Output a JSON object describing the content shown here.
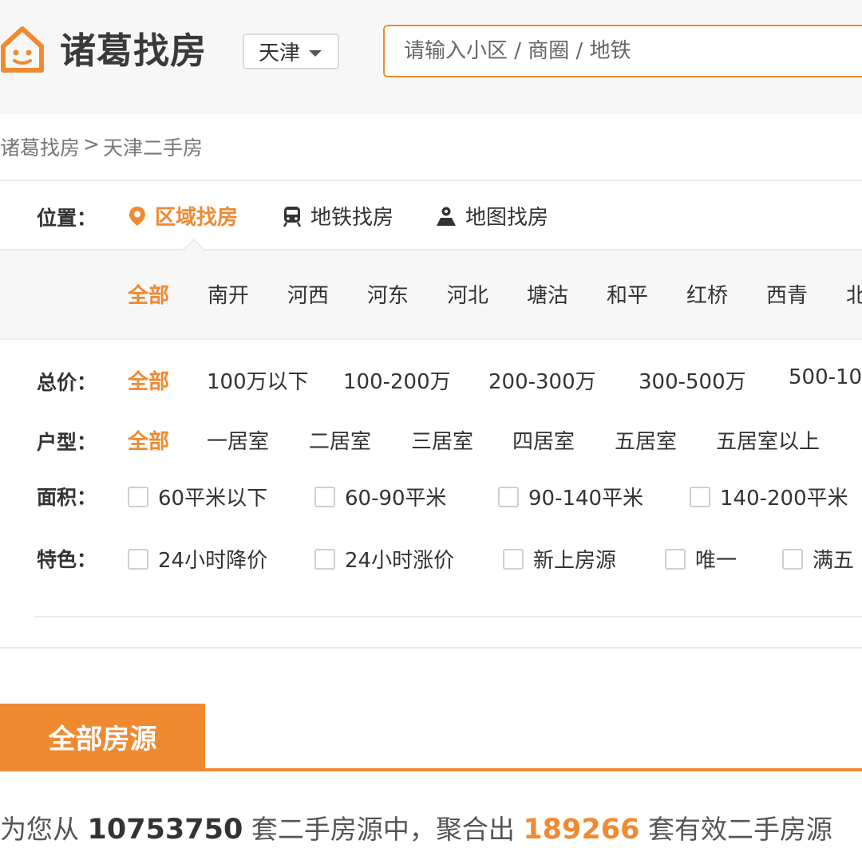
{
  "header": {
    "logo_text": "诸葛找房",
    "city": "天津",
    "search_placeholder": "请输入小区 / 商圈 / 地铁"
  },
  "breadcrumb": {
    "home": "诸葛找房",
    "separator": ">",
    "current": "天津二手房"
  },
  "location": {
    "label": "位置：",
    "tabs": [
      "区域找房",
      "地铁找房",
      "地图找房"
    ],
    "active_tab": "区域找房",
    "districts": [
      "全部",
      "南开",
      "河西",
      "河东",
      "河北",
      "塘沽",
      "和平",
      "红桥",
      "西青",
      "北"
    ]
  },
  "filters": {
    "price": {
      "label": "总价：",
      "options": [
        "全部",
        "100万以下",
        "100-200万",
        "200-300万",
        "300-500万",
        "500-10"
      ]
    },
    "layout": {
      "label": "户型：",
      "options": [
        "全部",
        "一居室",
        "二居室",
        "三居室",
        "四居室",
        "五居室",
        "五居室以上"
      ]
    },
    "area": {
      "label": "面积：",
      "options": [
        "60平米以下",
        "60-90平米",
        "90-140平米",
        "140-200平米"
      ]
    },
    "feature": {
      "label": "特色：",
      "options": [
        "24小时降价",
        "24小时涨价",
        "新上房源",
        "唯一",
        "满五"
      ]
    }
  },
  "tabs": {
    "all_listings": "全部房源"
  },
  "summary": {
    "prefix": "为您从",
    "total": "10753750",
    "middle": "套二手房源中，聚合出",
    "valid": "189266",
    "suffix": "套有效二手房源"
  },
  "colors": {
    "accent": "#ef8a31",
    "header_bg": "#f7f7f7",
    "text": "#333333"
  },
  "icons": {
    "logo": "house-face-icon",
    "location_tabs": [
      "map-pin-icon",
      "subway-train-icon",
      "map-person-icon"
    ],
    "city_select": "caret-down-icon"
  }
}
